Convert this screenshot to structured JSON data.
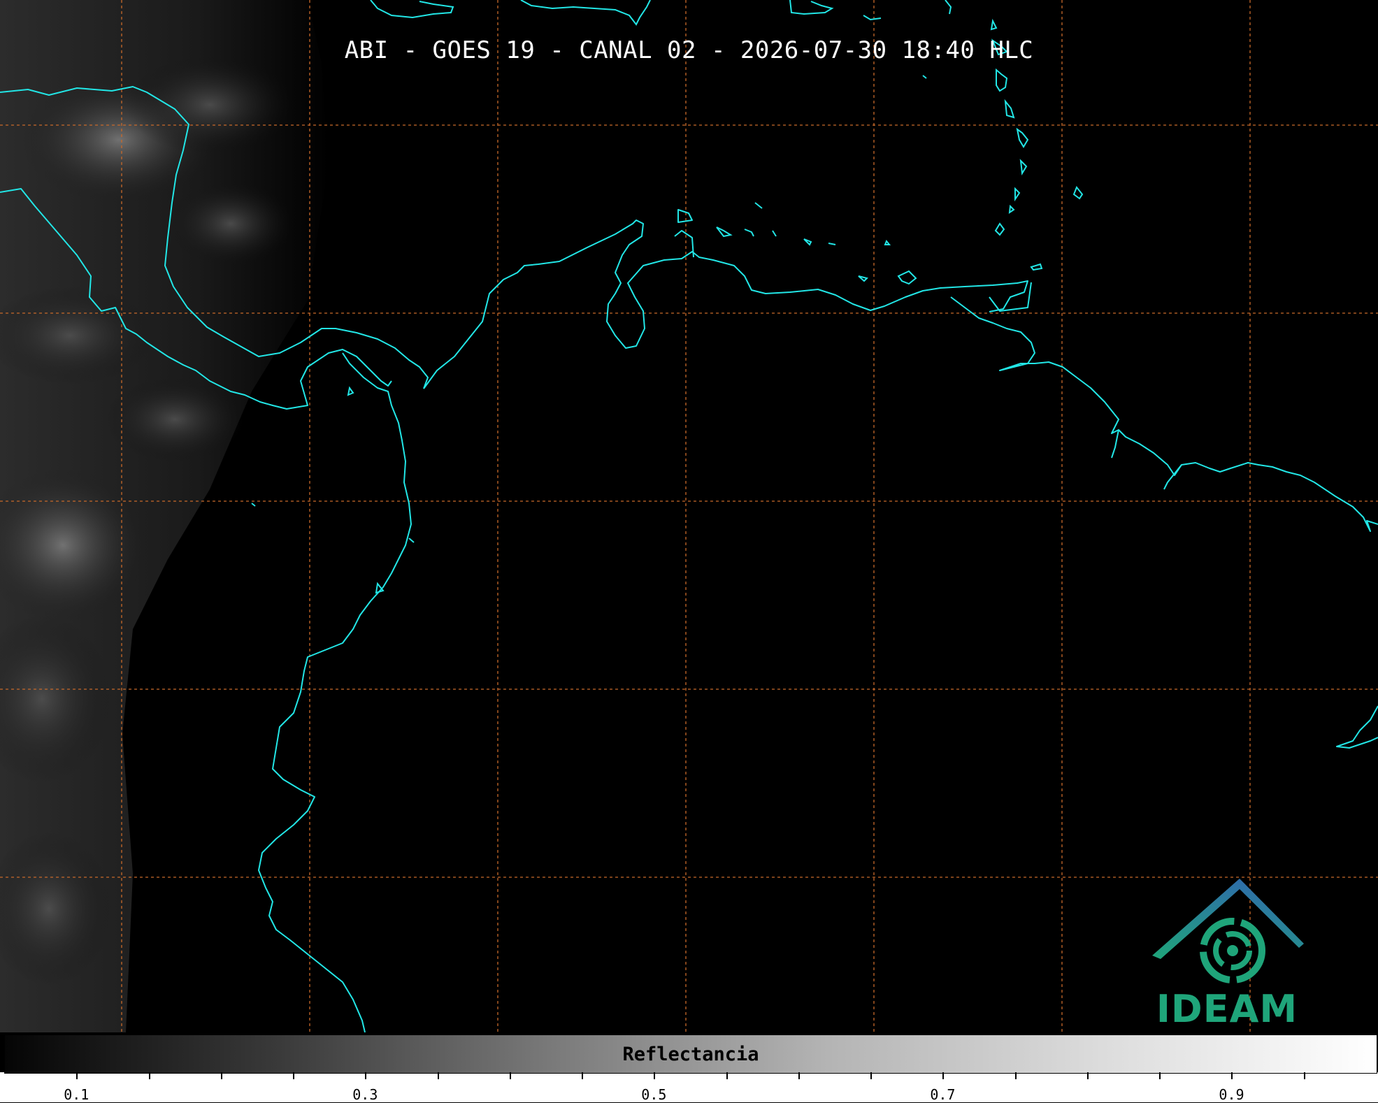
{
  "title": "ABI - GOES 19 - CANAL 02 - 2026-07-30 18:40 HLC",
  "colors": {
    "coastline": "#22e6e6",
    "grid": "#c8692a",
    "background": "#000000",
    "logo_teal": "#1fa57a",
    "logo_blue": "#2e6fa8"
  },
  "colorbar": {
    "label": "Reflectancia",
    "ticks": [
      "0.1",
      "0.3",
      "0.5",
      "0.7",
      "0.9"
    ],
    "tick_values": [
      0.1,
      0.3,
      0.5,
      0.7,
      0.9
    ],
    "range": [
      0.05,
      1.0
    ]
  },
  "logo": {
    "text": "IDEAM"
  }
}
